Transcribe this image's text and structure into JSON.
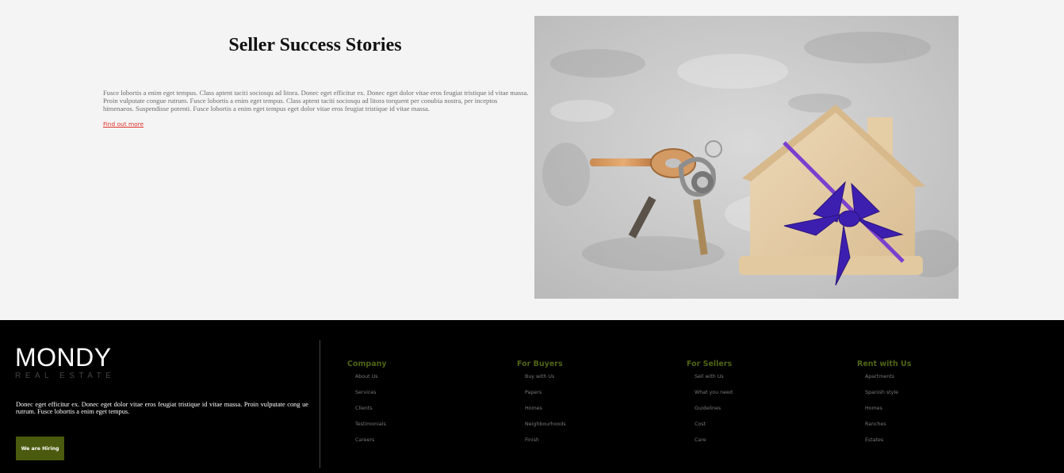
{
  "story": {
    "title": "Seller Success Stories",
    "body": "Fusce lobortis a enim eget tempus. Class aptent taciti sociosqu ad litora. Donec eget efficitur ex. Donec eget dolor vitae eros feugiat tristique id vitae massa. Proin vulputate congue rutrum. Fusce lobortis a enim eget tempus. Class aptent taciti sociosqu ad litora torquent per conubia nostra, per inceptos himenaeos. Suspendisse potenti. Fusce lobortis a enim eget tempus eget dolor vitae eros feugiat tristique id vitae massa.",
    "link_label": "Find out more"
  },
  "footer": {
    "logo_main": "MONDY",
    "logo_sub": "REAL ESTATE",
    "text": "Donec eget efficitur ex. Donec eget dolor vitae eros feugiat tristique id vitae massa. Proin vulputate cong ue rutrum. Fusce lobortis a enim eget tempus.",
    "hiring_label": "We are Hiring",
    "columns": [
      {
        "title": "Company",
        "items": [
          "About Us",
          "Services",
          "Clients",
          "Testimonials",
          "Careers"
        ]
      },
      {
        "title": "For Buyers",
        "items": [
          "Buy with Us",
          "Papers",
          "Homes",
          "Neighbourhoods",
          "Finish"
        ]
      },
      {
        "title": "For Sellers",
        "items": [
          "Sell with Us",
          "What you need",
          "Guidelines",
          "Cost",
          "Care"
        ]
      },
      {
        "title": "Rent with Us",
        "items": [
          "Apartments",
          "Spanish style",
          "Homes",
          "Ranches",
          "Estates"
        ]
      }
    ]
  },
  "colors": {
    "accent_green": "#4f6413",
    "button_green": "#4a5a0e",
    "link_red": "#e0302b",
    "footer_bg": "#000000",
    "page_bg": "#f4f4f4"
  }
}
